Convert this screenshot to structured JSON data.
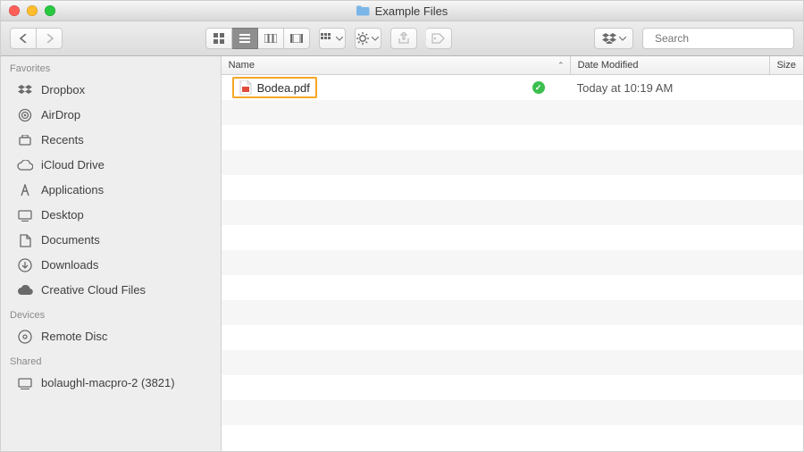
{
  "window": {
    "title": "Example Files"
  },
  "toolbar": {
    "search_placeholder": "Search"
  },
  "sidebar": {
    "sections": [
      {
        "title": "Favorites",
        "items": [
          {
            "icon": "dropbox",
            "label": "Dropbox"
          },
          {
            "icon": "airdrop",
            "label": "AirDrop"
          },
          {
            "icon": "recents",
            "label": "Recents"
          },
          {
            "icon": "icloud",
            "label": "iCloud Drive"
          },
          {
            "icon": "apps",
            "label": "Applications"
          },
          {
            "icon": "desktop",
            "label": "Desktop"
          },
          {
            "icon": "docs",
            "label": "Documents"
          },
          {
            "icon": "downloads",
            "label": "Downloads"
          },
          {
            "icon": "ccloud",
            "label": "Creative Cloud Files"
          }
        ]
      },
      {
        "title": "Devices",
        "items": [
          {
            "icon": "disc",
            "label": "Remote Disc"
          }
        ]
      },
      {
        "title": "Shared",
        "items": [
          {
            "icon": "computer",
            "label": "bolaughl-macpro-2 (3821)"
          }
        ]
      }
    ]
  },
  "columns": {
    "name": "Name",
    "date": "Date Modified",
    "size": "Size",
    "sort_icon": "⌃"
  },
  "files": [
    {
      "name": "Bodea.pdf",
      "date": "Today at 10:19 AM",
      "synced": true,
      "highlighted": true
    }
  ]
}
